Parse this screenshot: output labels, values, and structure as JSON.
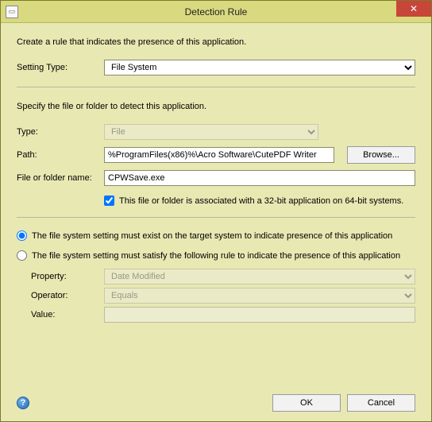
{
  "window": {
    "title": "Detection Rule"
  },
  "intro": "Create a rule that indicates the presence of this application.",
  "settingType": {
    "label": "Setting Type:",
    "value": "File System"
  },
  "specify": "Specify the file or folder to detect this application.",
  "type": {
    "label": "Type:",
    "value": "File"
  },
  "path": {
    "label": "Path:",
    "value": "%ProgramFiles(x86)%\\Acro Software\\CutePDF Writer",
    "browse": "Browse..."
  },
  "filename": {
    "label": "File or folder name:",
    "value": "CPWSave.exe"
  },
  "assoc32": {
    "label": "This file or folder is associated with a 32-bit application on 64-bit systems.",
    "checked": true
  },
  "radios": {
    "exist": "The file system setting must exist on the target system to indicate presence of this application",
    "rule": "The file system setting must satisfy the following rule to indicate the presence of this application",
    "selected": "exist"
  },
  "rule": {
    "property": {
      "label": "Property:",
      "value": "Date Modified"
    },
    "operator": {
      "label": "Operator:",
      "value": "Equals"
    },
    "value": {
      "label": "Value:",
      "value": ""
    }
  },
  "footer": {
    "ok": "OK",
    "cancel": "Cancel"
  }
}
